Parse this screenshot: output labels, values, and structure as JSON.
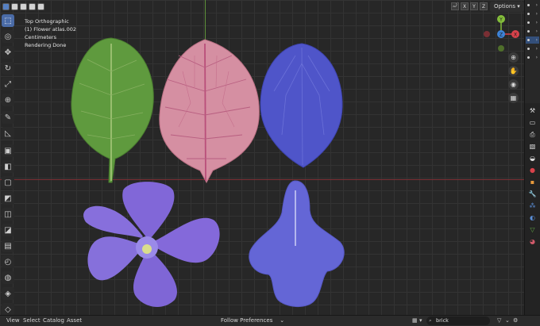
{
  "viewport": {
    "view_name": "Top Orthographic",
    "object_name": "(1) Flower atlas.002",
    "units": "Centimeters",
    "status": "Rendering Done"
  },
  "header": {
    "options_label": "Options",
    "axis_labels": [
      "X",
      "Y",
      "Z"
    ]
  },
  "gizmo": {
    "y_label": "Y",
    "x_label": "X",
    "z_label": "Z",
    "colors": {
      "x": "#d8424b",
      "y": "#83bd3a",
      "z": "#3d83d8"
    }
  },
  "toolbar": {
    "tools": [
      "select-box",
      "cursor",
      "move",
      "rotate",
      "scale",
      "transform",
      "annotate",
      "measure",
      "add-cube",
      "extrude",
      "inset",
      "bevel",
      "loop-cut",
      "knife",
      "poly-build",
      "spin",
      "smooth",
      "shrink-fatten",
      "shear",
      "rip"
    ]
  },
  "bottombar": {
    "menus": [
      "View",
      "Select",
      "Catalog",
      "Asset"
    ],
    "follow_prefs": "Follow Preferences",
    "search_value": "brick"
  },
  "petals": {
    "green_leaf": "#5f9a3e",
    "pink_leaf": "#d58fa2",
    "blue_petal": "#4f55c9",
    "violet_flower": "#8167d8",
    "lavender_petal": "#6466d6"
  }
}
